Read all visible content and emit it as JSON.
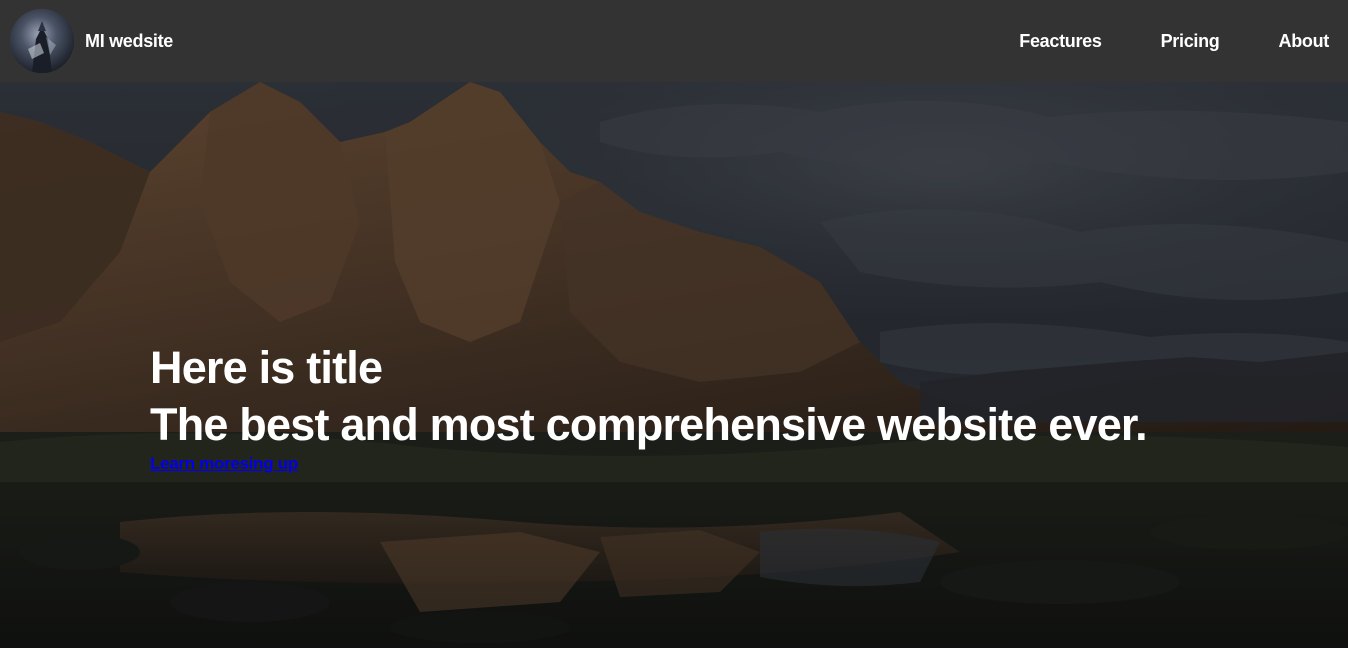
{
  "navbar": {
    "brand_name": "MI wedsite",
    "links": [
      {
        "label": "Feactures"
      },
      {
        "label": "Pricing"
      },
      {
        "label": "About"
      }
    ]
  },
  "hero": {
    "title": "Here is title",
    "subtitle": "The best and most comprehensive website ever.",
    "link_label": "Learn moresing up"
  },
  "colors": {
    "navbar_bg": "#333333",
    "text": "#ffffff",
    "link": "#0000ee"
  }
}
